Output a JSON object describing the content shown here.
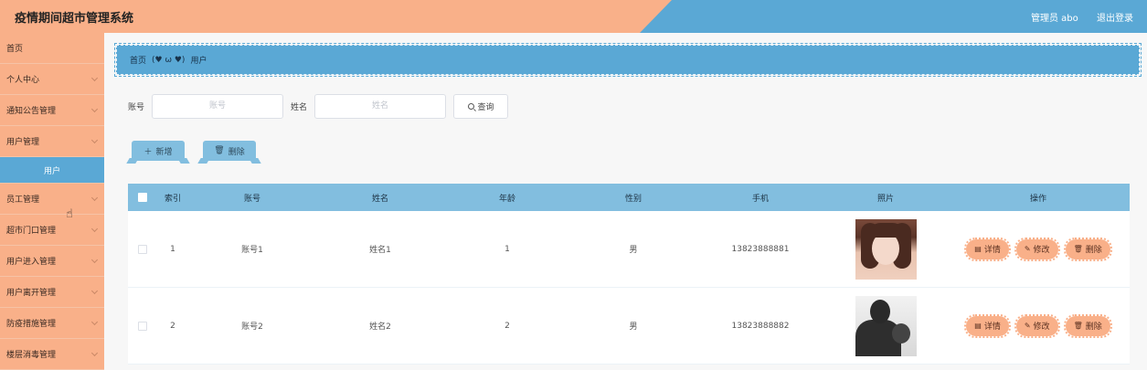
{
  "header": {
    "title": "疫情期间超市管理系统",
    "user": "管理员 abo",
    "logout": "退出登录"
  },
  "sidebar": {
    "items": [
      {
        "label": "首页",
        "expandable": false
      },
      {
        "label": "个人中心",
        "expandable": true
      },
      {
        "label": "通知公告管理",
        "expandable": true
      },
      {
        "label": "用户管理",
        "expandable": true
      },
      {
        "label": "用户",
        "sub": true
      },
      {
        "label": "员工管理",
        "expandable": true
      },
      {
        "label": "超市门口管理",
        "expandable": true
      },
      {
        "label": "用户进入管理",
        "expandable": true
      },
      {
        "label": "用户离开管理",
        "expandable": true
      },
      {
        "label": "防疫措施管理",
        "expandable": true
      },
      {
        "label": "楼层消毒管理",
        "expandable": true
      }
    ]
  },
  "breadcrumb": {
    "home": "首页",
    "sep": "(♥ ω ♥)",
    "current": "用户"
  },
  "search": {
    "account_label": "账号",
    "account_placeholder": "账号",
    "name_label": "姓名",
    "name_placeholder": "姓名",
    "query_label": "查询"
  },
  "actions": {
    "add": "新增",
    "delete": "删除"
  },
  "table": {
    "columns": [
      "索引",
      "账号",
      "姓名",
      "年龄",
      "性别",
      "手机",
      "照片",
      "操作"
    ],
    "rows": [
      {
        "index": "1",
        "account": "账号1",
        "name": "姓名1",
        "age": "1",
        "gender": "男",
        "phone": "13823888881",
        "photo": "girl-portrait"
      },
      {
        "index": "2",
        "account": "账号2",
        "name": "姓名2",
        "age": "2",
        "gender": "男",
        "phone": "13823888882",
        "photo": "silhouette-portrait"
      }
    ],
    "ops": {
      "detail": "详情",
      "edit": "修改",
      "delete": "删除"
    }
  },
  "colors": {
    "orange": "#f9b089",
    "blue": "#5aa8d5",
    "light_blue": "#82bedf"
  }
}
